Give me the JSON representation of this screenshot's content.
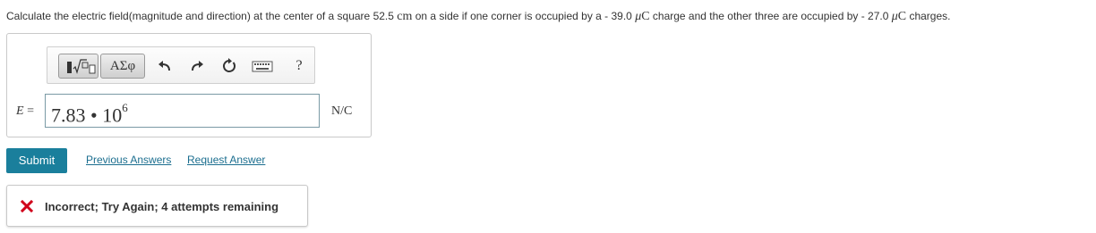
{
  "question": {
    "part1": "Calculate the electric field(magnitude and direction) at the center of a square 52.5 ",
    "unit_cm": "cm",
    "part2": " on a side if one corner is occupied by a - 39.0 ",
    "mu1": "μ",
    "c1": "C",
    "part3": " charge and the other three are occupied by - 27.0 ",
    "mu2": "μ",
    "c2": "C",
    "part4": " charges."
  },
  "toolbar": {
    "greek_label": "ΑΣφ",
    "help_label": "?"
  },
  "answer": {
    "variable": "E",
    "equals": " =",
    "value_mantissa": "7.83 • 10",
    "value_exponent": "6",
    "unit": "N/C"
  },
  "actions": {
    "submit_label": "Submit",
    "previous_answers_label": "Previous Answers",
    "request_answer_label": "Request Answer"
  },
  "feedback": {
    "icon": "x-mark-icon",
    "text": "Incorrect; Try Again; 4 attempts remaining",
    "color": "#d0021b"
  },
  "colors": {
    "submit_bg": "#1a7f9c",
    "link": "#1b6e8f"
  }
}
